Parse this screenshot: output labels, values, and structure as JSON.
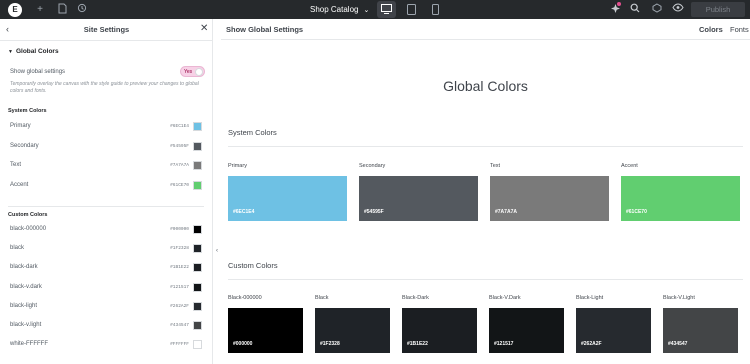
{
  "topbar": {
    "logo": "E",
    "page_title": "Shop Catalog",
    "publish_label": "Publish"
  },
  "panel": {
    "title": "Site Settings",
    "section_title": "Global Colors",
    "show_global_label": "Show global settings",
    "toggle_label": "Yes",
    "help_text": "Temporarily overlay the canvas with the style guide to preview your changes to global colors and fonts.",
    "system_title": "System Colors",
    "system_colors": [
      {
        "name": "Primary",
        "hex": "#6EC1E4",
        "color": "#6ec1e4"
      },
      {
        "name": "Secondary",
        "hex": "#54595F",
        "color": "#54595f"
      },
      {
        "name": "Text",
        "hex": "#7A7A7A",
        "color": "#7a7a7a"
      },
      {
        "name": "Accent",
        "hex": "#61CE70",
        "color": "#61ce70"
      }
    ],
    "custom_title": "Custom Colors",
    "custom_colors": [
      {
        "name": "black-000000",
        "hex": "#000000",
        "color": "#000000"
      },
      {
        "name": "black",
        "hex": "#1F2328",
        "color": "#1f2328"
      },
      {
        "name": "black-dark",
        "hex": "#1B1E22",
        "color": "#1b1e22"
      },
      {
        "name": "black-v.dark",
        "hex": "#121517",
        "color": "#121517"
      },
      {
        "name": "black-light",
        "hex": "#262A2F",
        "color": "#262a2f"
      },
      {
        "name": "black-v.light",
        "hex": "#434547",
        "color": "#434547"
      },
      {
        "name": "white-FFFFFF",
        "hex": "#FFFFFF",
        "color": "#ffffff"
      }
    ]
  },
  "canvas": {
    "header_title": "Show Global Settings",
    "tabs": [
      "Colors",
      "Fonts"
    ],
    "big_title": "Global Colors",
    "system_title": "System Colors",
    "system_cards": [
      {
        "label": "Primary",
        "code": "#6EC1E4",
        "color": "#6ec1e4"
      },
      {
        "label": "Secondary",
        "code": "#54595F",
        "color": "#54595f"
      },
      {
        "label": "Text",
        "code": "#7A7A7A",
        "color": "#7a7a7a"
      },
      {
        "label": "Accent",
        "code": "#61CE70",
        "color": "#61ce70"
      }
    ],
    "custom_title": "Custom Colors",
    "custom_cards": [
      {
        "label": "Black-000000",
        "code": "#000000",
        "color": "#000000"
      },
      {
        "label": "Black",
        "code": "#1F2328",
        "color": "#1f2328"
      },
      {
        "label": "Black-Dark",
        "code": "#1B1E22",
        "color": "#1b1e22"
      },
      {
        "label": "Black-V.Dark",
        "code": "#121517",
        "color": "#121517"
      },
      {
        "label": "Black-Light",
        "code": "#262A2F",
        "color": "#262a2f"
      },
      {
        "label": "Black-V.Light",
        "code": "#434547",
        "color": "#434547"
      }
    ]
  }
}
